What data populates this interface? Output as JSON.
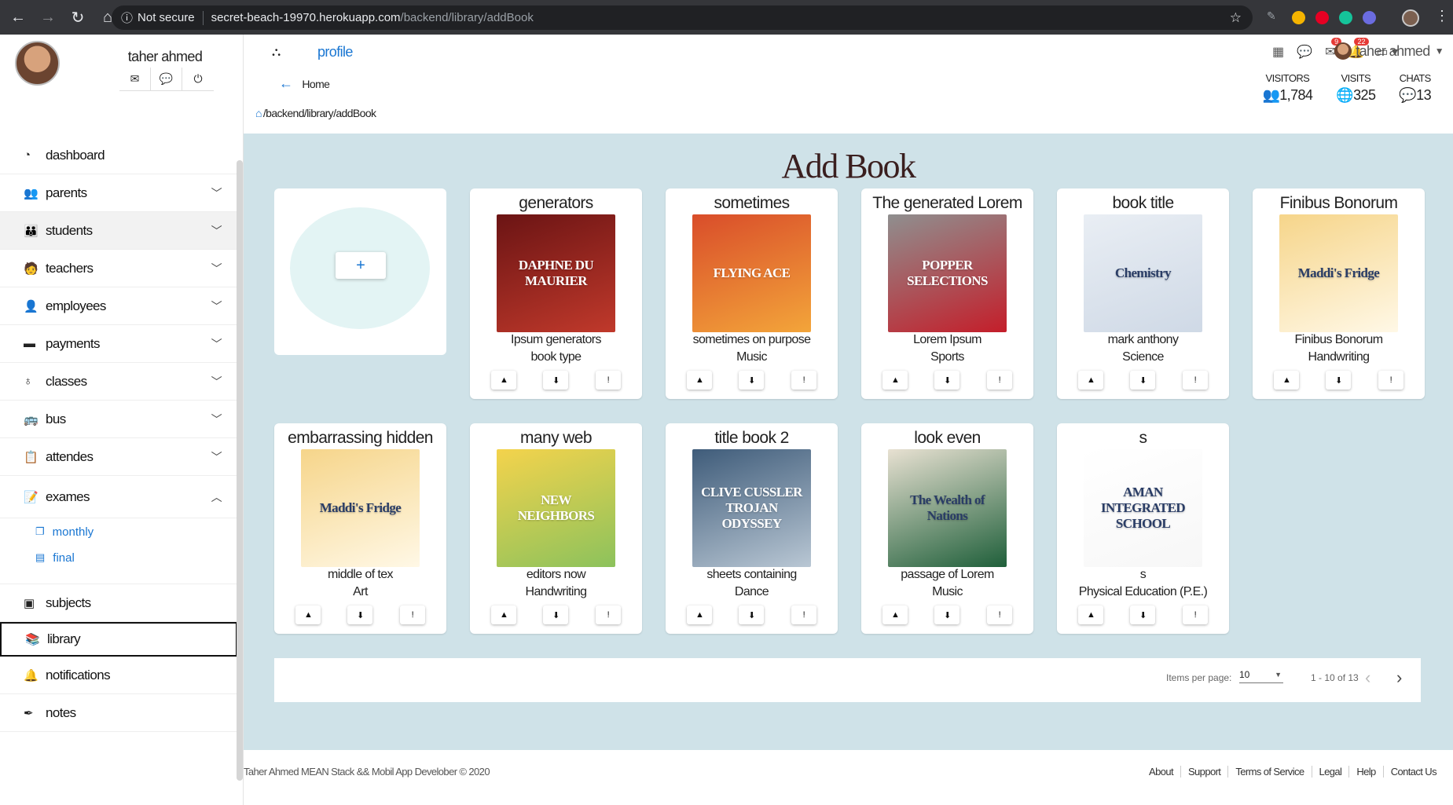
{
  "browser": {
    "security": "Not secure",
    "url_host": "secret-beach-19970.herokuapp.com",
    "url_path": "/backend/library/addBook",
    "badge_red_1": "9",
    "badge_red_2": "22"
  },
  "sidebar": {
    "user_name": "taher ahmed",
    "items": [
      {
        "label": "dashboard",
        "icon": "dashboard-icon",
        "glyph": "◔",
        "chevron": ""
      },
      {
        "label": "parents",
        "icon": "users-icon",
        "glyph": "👥",
        "chevron": "⌄"
      },
      {
        "label": "students",
        "icon": "child-icon",
        "glyph": "👪",
        "chevron": "⌄"
      },
      {
        "label": "teachers",
        "icon": "chalkboard-icon",
        "glyph": "🧑",
        "chevron": "⌄"
      },
      {
        "label": "employees",
        "icon": "user-icon",
        "glyph": "👤",
        "chevron": "⌄"
      },
      {
        "label": "payments",
        "icon": "wallet-icon",
        "glyph": "▬",
        "chevron": "⌄"
      },
      {
        "label": "classes",
        "icon": "lightbulb-icon",
        "glyph": "♁",
        "chevron": "⌄"
      },
      {
        "label": "bus",
        "icon": "bus-icon",
        "glyph": "🚌",
        "chevron": "⌄"
      },
      {
        "label": "attendes",
        "icon": "clipboard-icon",
        "glyph": "📋",
        "chevron": "⌄"
      },
      {
        "label": "exames",
        "icon": "file-signature-icon",
        "glyph": "📝",
        "chevron": "⌃"
      }
    ],
    "sub_items": [
      {
        "label": "monthly",
        "icon": "copy-icon"
      },
      {
        "label": "final",
        "icon": "file-icon"
      }
    ],
    "bottom_items": [
      {
        "label": "subjects",
        "icon": "book-icon"
      },
      {
        "label": "library",
        "icon": "book-reader-icon"
      },
      {
        "label": "notifications",
        "icon": "bell-icon"
      },
      {
        "label": "notes",
        "icon": "pen-icon"
      }
    ]
  },
  "topbar": {
    "profile_link": "profile",
    "user_name": "taher ahmed",
    "badge_messages": "9",
    "badge_notifications": "22"
  },
  "breadcrumb": {
    "back_label": "Home",
    "path": "/backend/library/addBook"
  },
  "stats": [
    {
      "label": "VISITORS",
      "value": "1,784",
      "icon": "users-icon"
    },
    {
      "label": "VISITS",
      "value": "325",
      "icon": "globe-icon"
    },
    {
      "label": "CHATS",
      "value": "13",
      "icon": "comments-icon"
    }
  ],
  "page": {
    "title": "Add Book",
    "add_button": "+"
  },
  "books": [
    {
      "title": "generators",
      "line1": "Ipsum generators",
      "line2": "book type",
      "cover_text": "DAPHNE DU MAURIER",
      "cover_colors": [
        "#6b1414",
        "#c0392b"
      ]
    },
    {
      "title": "sometimes",
      "line1": "sometimes on purpose",
      "line2": "Music",
      "cover_text": "FLYING ACE",
      "cover_colors": [
        "#d94d2a",
        "#f3a53a"
      ]
    },
    {
      "title": "The generated Lorem",
      "line1": "Lorem Ipsum",
      "line2": "Sports",
      "cover_text": "POPPER SELECTIONS",
      "cover_colors": [
        "#8f8f8f",
        "#c41e2a"
      ]
    },
    {
      "title": "book title",
      "line1": "mark anthony",
      "line2": "Science",
      "cover_text": "Chemistry",
      "cover_colors": [
        "#e9eef4",
        "#cfd9e6"
      ]
    },
    {
      "title": "Finibus Bonorum",
      "line1": "Finibus Bonorum",
      "line2": "Handwriting",
      "cover_text": "Maddi's Fridge",
      "cover_colors": [
        "#f6d58a",
        "#fff8e6"
      ]
    },
    {
      "title": "embarrassing hidden",
      "line1": "middle of tex",
      "line2": "Art",
      "cover_text": "Maddi's Fridge",
      "cover_colors": [
        "#f6d58a",
        "#fff8e6"
      ]
    },
    {
      "title": "many web",
      "line1": "editors now",
      "line2": "Handwriting",
      "cover_text": "NEW NEIGHBORS",
      "cover_colors": [
        "#f4d34c",
        "#8cc25c"
      ]
    },
    {
      "title": "title book 2",
      "line1": "sheets containing",
      "line2": "Dance",
      "cover_text": "CLIVE CUSSLER TROJAN ODYSSEY",
      "cover_colors": [
        "#3f5c7a",
        "#b9c7d4"
      ]
    },
    {
      "title": "look even",
      "line1": "passage of Lorem",
      "line2": "Music",
      "cover_text": "The Wealth of Nations",
      "cover_colors": [
        "#e8e1d2",
        "#1f5f3a"
      ]
    },
    {
      "title": "s",
      "line1": "s",
      "line2": "Physical Education (P.E.)",
      "cover_text": "AMAN INTEGRATED SCHOOL",
      "cover_colors": [
        "#ffffff",
        "#f7f7f7"
      ]
    }
  ],
  "paginator": {
    "items_per_page_label": "Items per page:",
    "items_per_page": "10",
    "range": "1 - 10 of 13"
  },
  "footer": {
    "copyright": "Taher Ahmed MEAN Stack && Mobil App Develober © 2020",
    "links": [
      "About",
      "Support",
      "Terms of Service",
      "Legal",
      "Help",
      "Contact Us"
    ]
  }
}
